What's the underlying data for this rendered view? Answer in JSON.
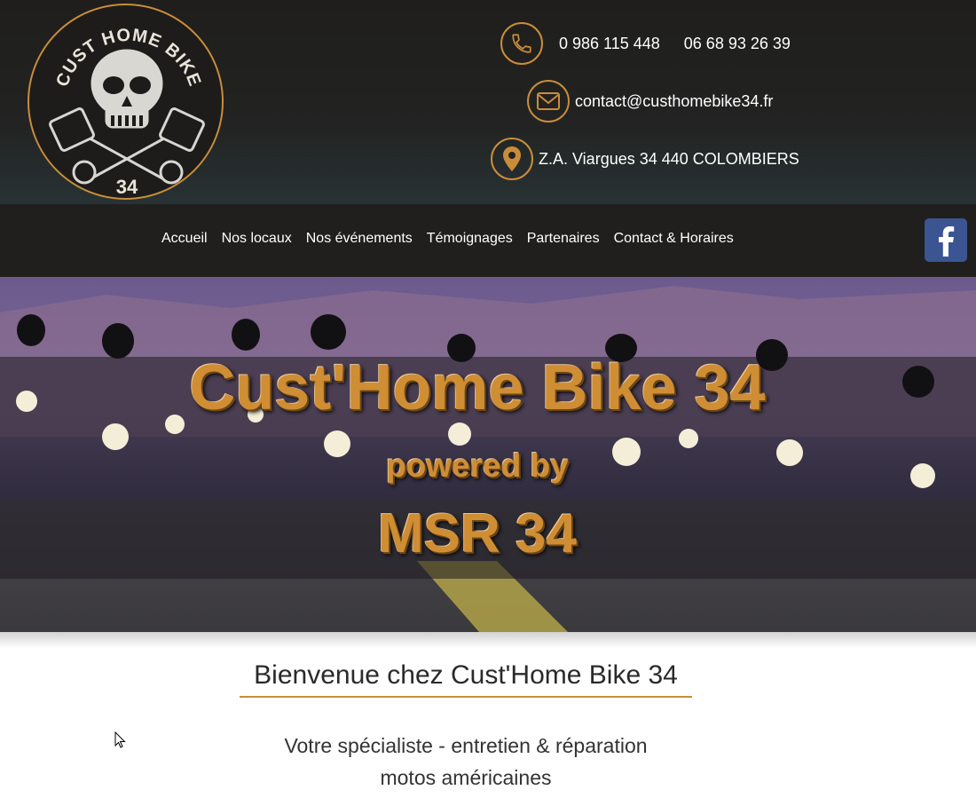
{
  "logo": {
    "text_top": "CUST HOME BIKE",
    "text_bottom": "34"
  },
  "contact": {
    "phone1": "0 986 115 448",
    "phone2": "06 68 93 26 39",
    "email": "contact@custhomebike34.fr",
    "address": "Z.A. Viargues  34 440 COLOMBIERS"
  },
  "nav": {
    "items": [
      {
        "label": "Accueil"
      },
      {
        "label": "Nos locaux"
      },
      {
        "label": "Nos événements"
      },
      {
        "label": "Témoignages"
      },
      {
        "label": "Partenaires"
      },
      {
        "label": "Contact & Horaires"
      }
    ]
  },
  "social": {
    "facebook_glyph": "f"
  },
  "hero": {
    "title": "Cust'Home Bike 34",
    "subtitle": "powered by",
    "brand": "MSR 34"
  },
  "main": {
    "welcome": "Bienvenue chez Cust'Home Bike 34",
    "tagline_line1": "Votre spécialiste - entretien & réparation",
    "tagline_line2": "motos américaines"
  },
  "colors": {
    "accent": "#c98d3a",
    "header_bg": "#1f1e1c",
    "facebook": "#3b5592"
  }
}
